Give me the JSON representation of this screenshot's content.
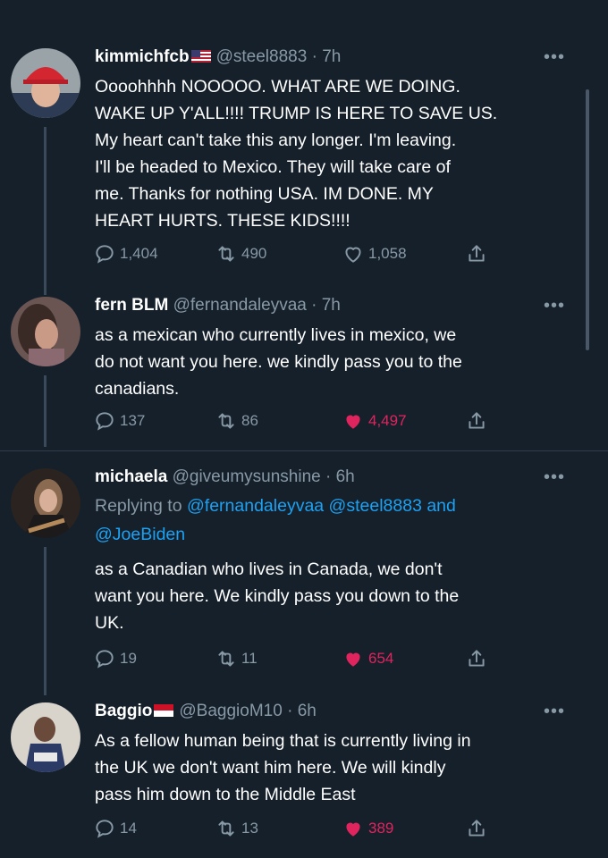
{
  "tweets": [
    {
      "name": "kimmichfcb",
      "flag": "us-flag",
      "handle": "@steel8883",
      "time": "7h",
      "more": "•••",
      "lines": [
        "Oooohhhh NOOOOO. WHAT ARE WE DOING.",
        "WAKE UP Y'ALL!!!! TRUMP IS HERE TO SAVE US.",
        "My heart can't take this any longer. I'm leaving.",
        "I'll be headed to Mexico. They will take care of",
        "me. Thanks for nothing USA. IM DONE. MY",
        "HEART HURTS. THESE KIDS!!!!"
      ],
      "replies": "1,404",
      "retweets": "490",
      "likes": "1,058",
      "liked": false
    },
    {
      "name": "fern BLM",
      "handle": "@fernandaleyvaa",
      "time": "7h",
      "more": "•••",
      "lines": [
        "as a mexican who currently lives in mexico, we",
        "do not want you here. we kindly pass you to the",
        "canadians."
      ],
      "replies": "137",
      "retweets": "86",
      "likes": "4,497",
      "liked": true
    },
    {
      "name": "michaela",
      "handle": "@giveumysunshine",
      "time": "6h",
      "more": "•••",
      "replying_prefix": "Replying to",
      "replying_mentions_line1": "@fernandaleyvaa @steel8883 and",
      "replying_mentions_line2": "@JoeBiden",
      "lines": [
        "as a Canadian who lives in Canada, we don't",
        "want you here. We kindly pass you down to the",
        "UK."
      ],
      "replies": "19",
      "retweets": "11",
      "likes": "654",
      "liked": true
    },
    {
      "name": "Baggio",
      "flag": "monaco-flag",
      "handle": "@BaggioM10",
      "time": "6h",
      "more": "•••",
      "lines": [
        "As a fellow human being that is currently living in",
        "the UK we don't want him here. We will kindly",
        "pass him down to the Middle East"
      ],
      "replies": "14",
      "retweets": "13",
      "likes": "389",
      "liked": true
    }
  ],
  "dot": "·",
  "colors": {
    "background": "#15202b",
    "secondary_text": "#8899a6",
    "link": "#1da1f2",
    "like": "#e0245e"
  }
}
